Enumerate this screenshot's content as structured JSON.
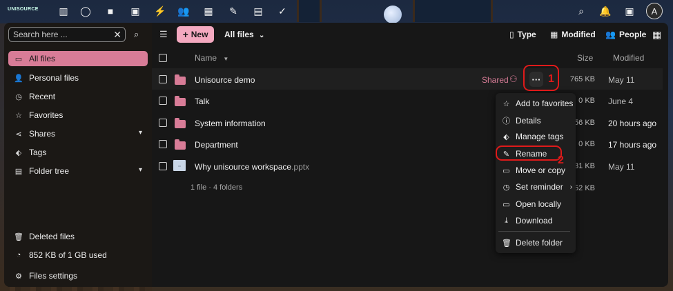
{
  "header": {
    "logo": "UNISOURCE",
    "apps": [
      "dashboard-icon",
      "search-circle-icon",
      "folder-icon",
      "photos-icon",
      "activity-icon",
      "contacts-icon",
      "calendar-icon",
      "notes-icon",
      "deck-icon",
      "tasks-icon"
    ],
    "avatar_letter": "A"
  },
  "sidebar": {
    "search_placeholder": "Search here ...",
    "items": [
      {
        "label": "All files",
        "icon": "folder-icon"
      },
      {
        "label": "Personal files",
        "icon": "user-icon"
      },
      {
        "label": "Recent",
        "icon": "history-icon"
      },
      {
        "label": "Favorites",
        "icon": "star-icon"
      },
      {
        "label": "Shares",
        "icon": "share-icon"
      },
      {
        "label": "Tags",
        "icon": "tag-icon"
      },
      {
        "label": "Folder tree",
        "icon": "folder-tree-icon"
      }
    ],
    "bottom": {
      "deleted": "Deleted files",
      "quota": "852 KB of 1 GB used",
      "settings": "Files settings"
    }
  },
  "toolbar": {
    "new_label": "New",
    "view_title": "All files",
    "type_label": "Type",
    "modified_label": "Modified",
    "people_label": "People"
  },
  "table": {
    "col_name": "Name",
    "col_size": "Size",
    "col_modified": "Modified",
    "rows": [
      {
        "name": "Unisource demo",
        "ext": "",
        "size": "765 KB",
        "modified": "May 11"
      },
      {
        "name": "Talk",
        "ext": "",
        "size": "0 KB",
        "modified": "June 4"
      },
      {
        "name": "System information",
        "ext": "",
        "size": "56 KB",
        "modified": "20 hours ago"
      },
      {
        "name": "Department",
        "ext": "",
        "size": "0 KB",
        "modified": "17 hours ago"
      },
      {
        "name": "Why unisource workspace",
        "ext": ".pptx",
        "size": "31 KB",
        "modified": "May 11"
      }
    ],
    "shared_label": "Shared",
    "summary": "1 file · 4 folders",
    "summary_size": "52 KB"
  },
  "menu": {
    "items": [
      {
        "label": "Add to favorites",
        "icon": "star-icon"
      },
      {
        "label": "Details",
        "icon": "info-icon"
      },
      {
        "label": "Manage tags",
        "icon": "tag-icon"
      },
      {
        "label": "Rename",
        "icon": "pencil-icon"
      },
      {
        "label": "Move or copy",
        "icon": "folder-move-icon"
      },
      {
        "label": "Set reminder",
        "icon": "alarm-icon"
      },
      {
        "label": "Open locally",
        "icon": "laptop-icon"
      },
      {
        "label": "Download",
        "icon": "download-icon"
      },
      {
        "label": "Delete folder",
        "icon": "trash-icon"
      }
    ]
  },
  "annotations": {
    "step1": "1",
    "step2": "2",
    "accent": "#e01a1a"
  },
  "colors": {
    "accent": "#d87c97",
    "new_button": "#f4a9c0"
  }
}
